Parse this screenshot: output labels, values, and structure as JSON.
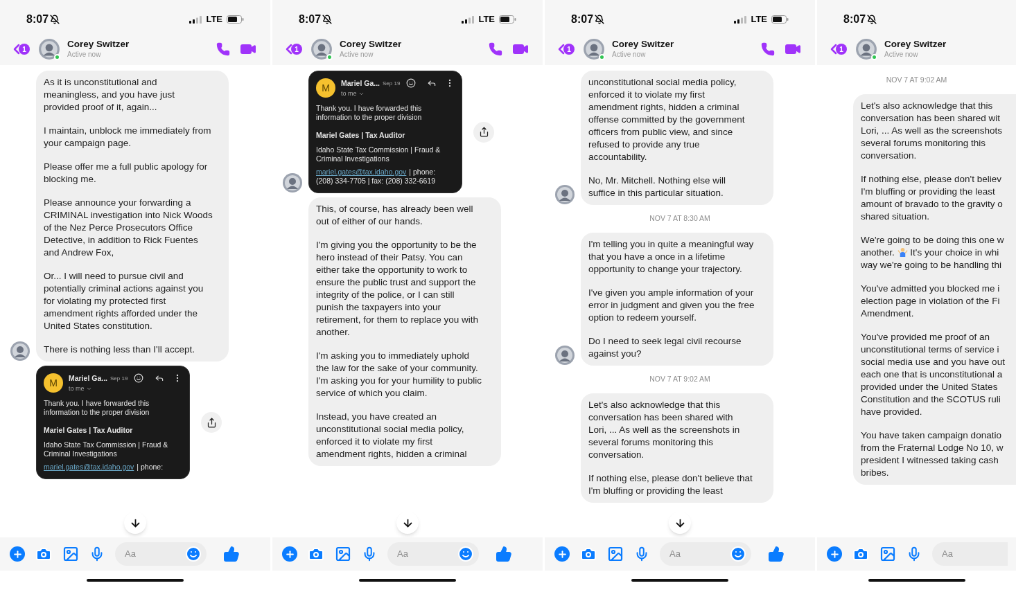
{
  "panels": [
    {
      "time": "8:07",
      "network": "LTE",
      "cropped": false,
      "scroll_button": true,
      "badge": "1",
      "contact": {
        "name": "Corey Switzer",
        "status": "Active now"
      },
      "composer_placeholder": "Aa",
      "messages": [
        {
          "kind": "bubble",
          "avatar": true,
          "paragraphs": [
            {
              "kind": "text",
              "text": "As it is unconstitutional and\nmeaningless, and you have just\nprovided proof of it, again..."
            },
            {
              "kind": "text",
              "text": "I maintain, unblock me immediately from\nyour campaign page."
            },
            {
              "kind": "text",
              "text": "Please offer me a full public apology for\nblocking me."
            },
            {
              "kind": "text",
              "text": "Please announce your forwarding a\nCRIMINAL investigation into Nick Woods\nof the Nez Perce Prosecutors Office\nDetective, in addition to Rick Fuentes\nand Andrew Fox,"
            },
            {
              "kind": "text",
              "text": "Or... I will need to pursue civil and\npotentially criminal actions against you\nfor violating my protected first\namendment rights afforded under the\nUnited States constitution."
            },
            {
              "kind": "text",
              "text": "There is nothing less than I'll accept."
            }
          ]
        },
        {
          "kind": "email",
          "avatar": false,
          "initial": "M",
          "sender": "Mariel Ga...",
          "date": "Sep 19",
          "to": "to me",
          "body": "Thank you. I have forwarded this\ninformation to the proper division",
          "signature": "Mariel Gates | Tax Auditor",
          "org": "Idaho State Tax Commission | Fraud &\nCriminal Investigations",
          "email": "mariel.gates@tax.idaho.gov",
          "contact": "| phone:"
        }
      ]
    },
    {
      "time": "8:07",
      "network": "LTE",
      "cropped": false,
      "scroll_button": true,
      "badge": "1",
      "contact": {
        "name": "Corey Switzer",
        "status": "Active now"
      },
      "composer_placeholder": "Aa",
      "messages": [
        {
          "kind": "email",
          "avatar": true,
          "initial": "M",
          "sender": "Mariel Ga...",
          "date": "Sep 19",
          "to": "to me",
          "body": "Thank you. I have forwarded this\ninformation to the proper division",
          "signature": "Mariel Gates | Tax Auditor",
          "org": "Idaho State Tax Commission | Fraud &\nCriminal Investigations",
          "email": "mariel.gates@tax.idaho.gov",
          "contact": "| phone:\n(208) 334-7705 | fax: (208) 332-6619"
        },
        {
          "kind": "bubble",
          "avatar": false,
          "paragraphs": [
            {
              "kind": "text",
              "text": "This, of course, has already been well\nout of either of our hands."
            },
            {
              "kind": "text",
              "text": "I'm giving you the opportunity to be the\nhero instead of their Patsy. You can\neither take the opportunity to work to\nensure the public trust and support the\nintegrity of the police, or I can still\npunish the taxpayers into your\nretirement, for them to replace you with\nanother."
            },
            {
              "kind": "text",
              "text": "I'm asking you to immediately uphold\nthe law for the sake of your community.\nI'm asking you for your humility to public\nservice of which you claim."
            },
            {
              "kind": "text",
              "text": "Instead, you have created an\nunconstitutional social media policy,\nenforced it to violate my first\namendment rights, hidden a criminal"
            }
          ]
        }
      ]
    },
    {
      "time": "8:07",
      "network": "LTE",
      "cropped": false,
      "scroll_button": true,
      "badge": "1",
      "contact": {
        "name": "Corey Switzer",
        "status": "Active now"
      },
      "composer_placeholder": "Aa",
      "messages": [
        {
          "kind": "bubble",
          "avatar": true,
          "paragraphs": [
            {
              "kind": "text",
              "text": "unconstitutional social media policy,\nenforced it to violate my first\namendment rights, hidden a criminal\noffense committed by the government\nofficers from public view, and since\nrefused to provide any true\naccountability."
            },
            {
              "kind": "text",
              "text": "No, Mr. Mitchell. Nothing else will\nsuffice in this particular situation."
            }
          ]
        },
        {
          "kind": "timestamp",
          "text": "NOV 7 AT 8:30 AM"
        },
        {
          "kind": "bubble",
          "avatar": true,
          "paragraphs": [
            {
              "kind": "text",
              "text": "I'm telling you in quite a meaningful way\nthat you have a once in a lifetime\nopportunity to change your trajectory."
            },
            {
              "kind": "text",
              "text": "I've given you ample information of your\nerror in judgment and given you the free\noption to redeem yourself."
            },
            {
              "kind": "text",
              "text": "Do I need to seek legal civil recourse\nagainst you?"
            }
          ]
        },
        {
          "kind": "timestamp",
          "text": "NOV 7 AT 9:02 AM"
        },
        {
          "kind": "bubble",
          "avatar": false,
          "paragraphs": [
            {
              "kind": "text",
              "text": "Let's also acknowledge that this\nconversation has been shared with\nLori, ... As well as the screenshots in\nseveral forums monitoring this\nconversation."
            },
            {
              "kind": "text",
              "text": "If nothing else, please don't believe that\nI'm bluffing or providing the least"
            }
          ]
        }
      ]
    },
    {
      "time": "8:07",
      "cropped": true,
      "scroll_button": false,
      "badge": "1",
      "contact": {
        "name": "Corey Switzer",
        "status": "Active now"
      },
      "composer_placeholder": "Aa",
      "messages": [
        {
          "kind": "timestamp",
          "text": "NOV 7 AT 9:02 AM"
        },
        {
          "kind": "bubble",
          "avatar": false,
          "paragraphs": [
            {
              "kind": "text",
              "text": "Let's also acknowledge that this\nconversation has been shared wit\nLori, ... As well as the screenshots\nseveral forums monitoring this\nconversation."
            },
            {
              "kind": "text",
              "text": "If nothing else, please don't believ\nI'm bluffing or providing the least\namount of bravado to the gravity o\nshared situation."
            },
            {
              "kind": "emoji",
              "before": "We're going to be doing this one w\nanother.",
              "after": "It's your choice in whi\nway we're going to be handling thi"
            },
            {
              "kind": "text",
              "text": "You've admitted you blocked me i\nelection page in violation of the Fi\nAmendment."
            },
            {
              "kind": "text",
              "text": "You've provided me proof of an\nunconstitutional terms of service i\nsocial media use and you have out\neach one that is unconstitutional a\nprovided under the United States\nConstitution and the SCOTUS ruli\nhave provided."
            },
            {
              "kind": "text",
              "text": "You have taken campaign donatio\nfrom the Fraternal Lodge No 10, w\npresident I witnessed taking cash\nbribes."
            }
          ]
        }
      ]
    }
  ]
}
